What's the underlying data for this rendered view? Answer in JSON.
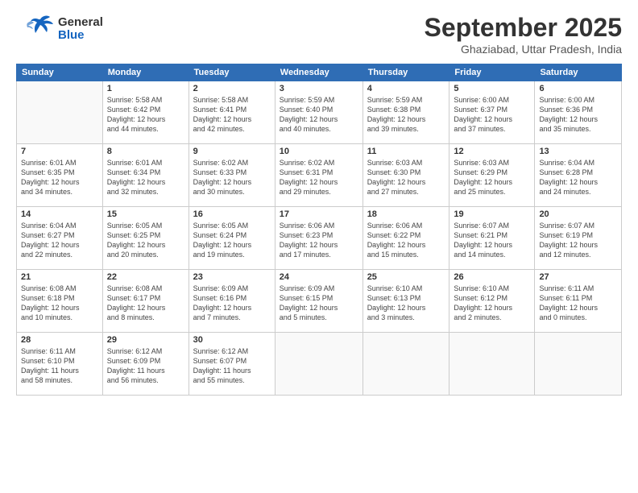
{
  "header": {
    "logo_general": "General",
    "logo_blue": "Blue",
    "month_title": "September 2025",
    "location": "Ghaziabad, Uttar Pradesh, India"
  },
  "days_of_week": [
    "Sunday",
    "Monday",
    "Tuesday",
    "Wednesday",
    "Thursday",
    "Friday",
    "Saturday"
  ],
  "weeks": [
    [
      {
        "num": "",
        "sunrise": "",
        "sunset": "",
        "daylight": ""
      },
      {
        "num": "1",
        "sunrise": "Sunrise: 5:58 AM",
        "sunset": "Sunset: 6:42 PM",
        "daylight": "Daylight: 12 hours and 44 minutes."
      },
      {
        "num": "2",
        "sunrise": "Sunrise: 5:58 AM",
        "sunset": "Sunset: 6:41 PM",
        "daylight": "Daylight: 12 hours and 42 minutes."
      },
      {
        "num": "3",
        "sunrise": "Sunrise: 5:59 AM",
        "sunset": "Sunset: 6:40 PM",
        "daylight": "Daylight: 12 hours and 40 minutes."
      },
      {
        "num": "4",
        "sunrise": "Sunrise: 5:59 AM",
        "sunset": "Sunset: 6:38 PM",
        "daylight": "Daylight: 12 hours and 39 minutes."
      },
      {
        "num": "5",
        "sunrise": "Sunrise: 6:00 AM",
        "sunset": "Sunset: 6:37 PM",
        "daylight": "Daylight: 12 hours and 37 minutes."
      },
      {
        "num": "6",
        "sunrise": "Sunrise: 6:00 AM",
        "sunset": "Sunset: 6:36 PM",
        "daylight": "Daylight: 12 hours and 35 minutes."
      }
    ],
    [
      {
        "num": "7",
        "sunrise": "Sunrise: 6:01 AM",
        "sunset": "Sunset: 6:35 PM",
        "daylight": "Daylight: 12 hours and 34 minutes."
      },
      {
        "num": "8",
        "sunrise": "Sunrise: 6:01 AM",
        "sunset": "Sunset: 6:34 PM",
        "daylight": "Daylight: 12 hours and 32 minutes."
      },
      {
        "num": "9",
        "sunrise": "Sunrise: 6:02 AM",
        "sunset": "Sunset: 6:33 PM",
        "daylight": "Daylight: 12 hours and 30 minutes."
      },
      {
        "num": "10",
        "sunrise": "Sunrise: 6:02 AM",
        "sunset": "Sunset: 6:31 PM",
        "daylight": "Daylight: 12 hours and 29 minutes."
      },
      {
        "num": "11",
        "sunrise": "Sunrise: 6:03 AM",
        "sunset": "Sunset: 6:30 PM",
        "daylight": "Daylight: 12 hours and 27 minutes."
      },
      {
        "num": "12",
        "sunrise": "Sunrise: 6:03 AM",
        "sunset": "Sunset: 6:29 PM",
        "daylight": "Daylight: 12 hours and 25 minutes."
      },
      {
        "num": "13",
        "sunrise": "Sunrise: 6:04 AM",
        "sunset": "Sunset: 6:28 PM",
        "daylight": "Daylight: 12 hours and 24 minutes."
      }
    ],
    [
      {
        "num": "14",
        "sunrise": "Sunrise: 6:04 AM",
        "sunset": "Sunset: 6:27 PM",
        "daylight": "Daylight: 12 hours and 22 minutes."
      },
      {
        "num": "15",
        "sunrise": "Sunrise: 6:05 AM",
        "sunset": "Sunset: 6:25 PM",
        "daylight": "Daylight: 12 hours and 20 minutes."
      },
      {
        "num": "16",
        "sunrise": "Sunrise: 6:05 AM",
        "sunset": "Sunset: 6:24 PM",
        "daylight": "Daylight: 12 hours and 19 minutes."
      },
      {
        "num": "17",
        "sunrise": "Sunrise: 6:06 AM",
        "sunset": "Sunset: 6:23 PM",
        "daylight": "Daylight: 12 hours and 17 minutes."
      },
      {
        "num": "18",
        "sunrise": "Sunrise: 6:06 AM",
        "sunset": "Sunset: 6:22 PM",
        "daylight": "Daylight: 12 hours and 15 minutes."
      },
      {
        "num": "19",
        "sunrise": "Sunrise: 6:07 AM",
        "sunset": "Sunset: 6:21 PM",
        "daylight": "Daylight: 12 hours and 14 minutes."
      },
      {
        "num": "20",
        "sunrise": "Sunrise: 6:07 AM",
        "sunset": "Sunset: 6:19 PM",
        "daylight": "Daylight: 12 hours and 12 minutes."
      }
    ],
    [
      {
        "num": "21",
        "sunrise": "Sunrise: 6:08 AM",
        "sunset": "Sunset: 6:18 PM",
        "daylight": "Daylight: 12 hours and 10 minutes."
      },
      {
        "num": "22",
        "sunrise": "Sunrise: 6:08 AM",
        "sunset": "Sunset: 6:17 PM",
        "daylight": "Daylight: 12 hours and 8 minutes."
      },
      {
        "num": "23",
        "sunrise": "Sunrise: 6:09 AM",
        "sunset": "Sunset: 6:16 PM",
        "daylight": "Daylight: 12 hours and 7 minutes."
      },
      {
        "num": "24",
        "sunrise": "Sunrise: 6:09 AM",
        "sunset": "Sunset: 6:15 PM",
        "daylight": "Daylight: 12 hours and 5 minutes."
      },
      {
        "num": "25",
        "sunrise": "Sunrise: 6:10 AM",
        "sunset": "Sunset: 6:13 PM",
        "daylight": "Daylight: 12 hours and 3 minutes."
      },
      {
        "num": "26",
        "sunrise": "Sunrise: 6:10 AM",
        "sunset": "Sunset: 6:12 PM",
        "daylight": "Daylight: 12 hours and 2 minutes."
      },
      {
        "num": "27",
        "sunrise": "Sunrise: 6:11 AM",
        "sunset": "Sunset: 6:11 PM",
        "daylight": "Daylight: 12 hours and 0 minutes."
      }
    ],
    [
      {
        "num": "28",
        "sunrise": "Sunrise: 6:11 AM",
        "sunset": "Sunset: 6:10 PM",
        "daylight": "Daylight: 11 hours and 58 minutes."
      },
      {
        "num": "29",
        "sunrise": "Sunrise: 6:12 AM",
        "sunset": "Sunset: 6:09 PM",
        "daylight": "Daylight: 11 hours and 56 minutes."
      },
      {
        "num": "30",
        "sunrise": "Sunrise: 6:12 AM",
        "sunset": "Sunset: 6:07 PM",
        "daylight": "Daylight: 11 hours and 55 minutes."
      },
      {
        "num": "",
        "sunrise": "",
        "sunset": "",
        "daylight": ""
      },
      {
        "num": "",
        "sunrise": "",
        "sunset": "",
        "daylight": ""
      },
      {
        "num": "",
        "sunrise": "",
        "sunset": "",
        "daylight": ""
      },
      {
        "num": "",
        "sunrise": "",
        "sunset": "",
        "daylight": ""
      }
    ]
  ]
}
